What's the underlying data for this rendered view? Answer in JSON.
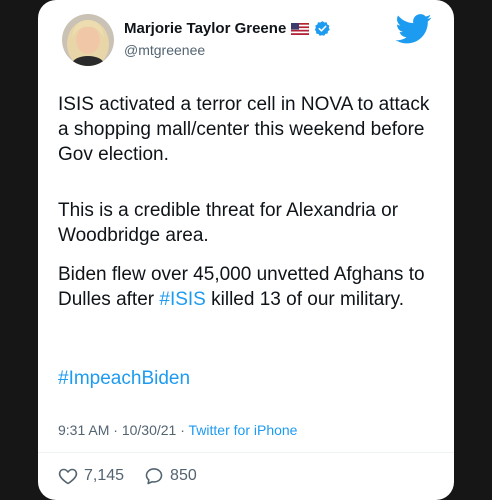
{
  "tweet": {
    "author_name": "Marjorie Taylor Greene",
    "handle": "@mtgreenee",
    "paragraphs": {
      "p1": "ISIS activated a terror cell in NOVA to attack a shopping mall/center this weekend before Gov election.",
      "p2": "This is a credible threat for Alexandria or Woodbridge area.",
      "p3_before": "Biden flew over 45,000 unvetted Afghans to Dulles after ",
      "p3_hashtag": "#ISIS",
      "p3_after": " killed 13 of our military.",
      "p4_hashtag": "#ImpeachBiden"
    },
    "time": "9:31 AM",
    "date": "10/30/21",
    "source": "Twitter for iPhone",
    "likes": "7,145",
    "replies": "850",
    "icons": {
      "flag": "us-flag-icon",
      "verified": "verified-badge-icon",
      "brand": "twitter-bird-icon",
      "like": "heart-icon",
      "reply": "reply-bubble-icon"
    },
    "colors": {
      "accent": "#1d9bf0",
      "text": "#0f1419",
      "muted": "#536471",
      "background": "#161616"
    }
  }
}
